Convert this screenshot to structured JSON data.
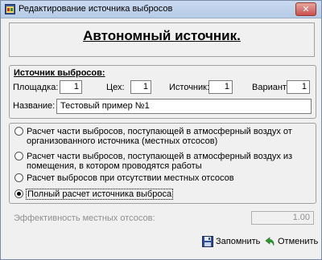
{
  "window": {
    "title": "Редактирование источника выбросов",
    "close_glyph": "✕"
  },
  "header": {
    "title": "Автономный источник."
  },
  "source": {
    "group_label": "Источник выбросов:",
    "area_label": "Площадка:",
    "area_value": "1",
    "shop_label": "Цех:",
    "shop_value": "1",
    "source_label": "Источник:",
    "source_value": "1",
    "variant_label": "Вариант:",
    "variant_value": "1",
    "name_label": "Название:",
    "name_value": "Тестовый пример №1"
  },
  "options": [
    {
      "label": "Расчет части выбросов, поступающей в атмосферный воздух от организованного источника (местных отсосов)",
      "checked": false
    },
    {
      "label": "Расчет части выбросов, поступающей в атмосферный воздух из помещения, в котором проводятся работы",
      "checked": false
    },
    {
      "label": "Расчет выбросов при отсутствии местных отсосов",
      "checked": false
    },
    {
      "label": "Полный расчет источника выброса",
      "checked": true
    }
  ],
  "efficiency": {
    "label": "Эффективность местных отсосов:",
    "value": "1.00"
  },
  "buttons": {
    "save_label": "Запомнить",
    "cancel_label": "Отменить"
  },
  "icons": {
    "app": "window-app-icon",
    "save": "floppy-disk-icon",
    "cancel": "green-undo-arrow-icon"
  }
}
